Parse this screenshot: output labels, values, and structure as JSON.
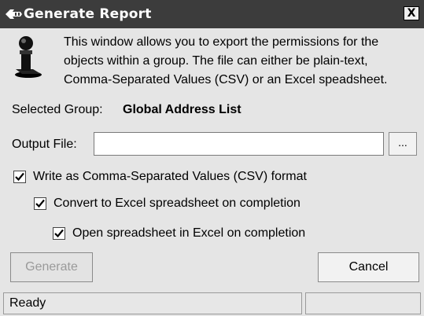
{
  "window": {
    "title": "Generate Report",
    "close_label": "X"
  },
  "description": {
    "lines": [
      "This window allows you to export the permissions for the",
      "objects within a group. The file can either be plain-text,",
      "Comma-Separated Values (CSV) or an Excel speadsheet."
    ]
  },
  "selected_group": {
    "label": "Selected Group:",
    "value": "Global Address List"
  },
  "output_file": {
    "label": "Output File:",
    "value": "",
    "browse_label": "..."
  },
  "options": [
    {
      "label": "Write as Comma-Separated Values (CSV) format",
      "checked": true
    },
    {
      "label": "Convert to Excel spreadsheet on completion",
      "checked": true
    },
    {
      "label": "Open spreadsheet in Excel on completion",
      "checked": true
    }
  ],
  "buttons": {
    "generate_label": "Generate",
    "generate_enabled": false,
    "cancel_label": "Cancel"
  },
  "status": {
    "text": "Ready",
    "right_text": ""
  },
  "icons": {
    "app": "key-icon",
    "dialog": "user-figure-icon"
  }
}
